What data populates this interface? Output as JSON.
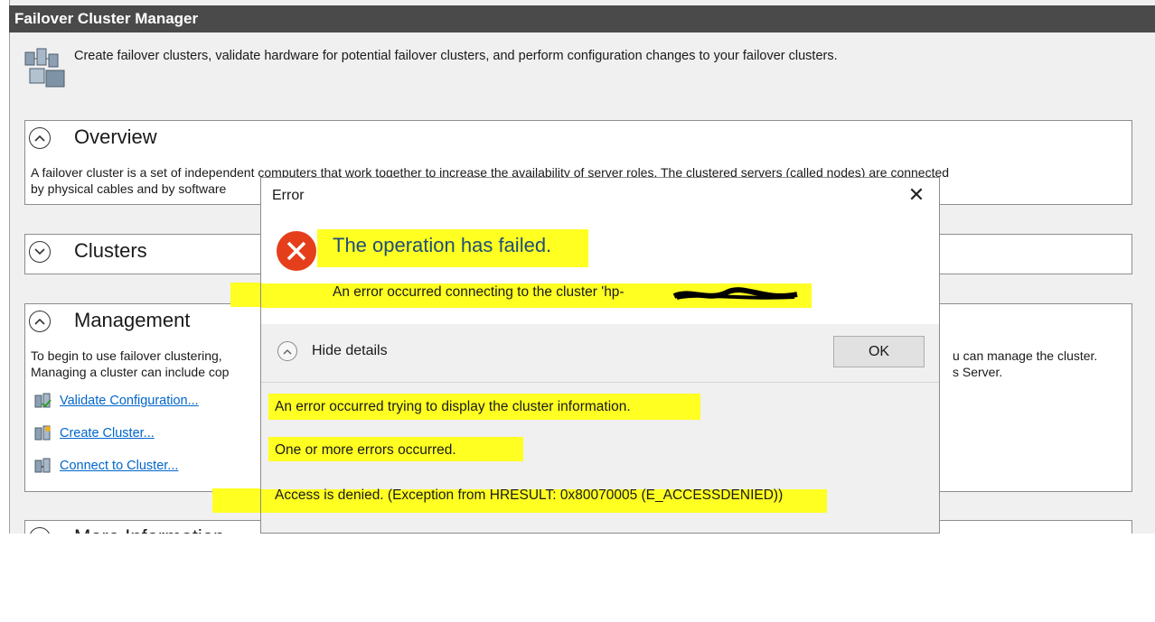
{
  "window": {
    "title": "Failover Cluster Manager"
  },
  "intro": {
    "text": "Create failover clusters, validate hardware for potential failover clusters, and perform configuration changes to your failover clusters."
  },
  "overview": {
    "title": "Overview",
    "line1": "A failover cluster is a set of independent computers that work together to increase the availability of server roles. The clustered servers (called nodes) are connected",
    "line2": "by physical cables and by software"
  },
  "clusters": {
    "title": "Clusters"
  },
  "management": {
    "title": "Management",
    "line1": "To begin to use failover clustering,",
    "line1_right": "u can manage the cluster.",
    "line2": "Managing a cluster can include cop",
    "line2_right": "s Server.",
    "actions": [
      "Validate Configuration...",
      "Create Cluster...",
      "Connect to Cluster..."
    ]
  },
  "more_info": {
    "title": "More Information"
  },
  "dialog": {
    "title": "Error",
    "close_glyph": "✕",
    "main_instruction": "The operation has failed.",
    "content": "An error occurred connecting to the cluster 'hp-",
    "details_label": "Hide details",
    "ok_label": "OK",
    "details": [
      "An error occurred trying to display the cluster information.",
      "One or more errors occurred.",
      "Access is denied. (Exception from HRESULT: 0x80070005 (E_ACCESSDENIED))"
    ]
  },
  "icons": {
    "app": "cluster-manager-icon",
    "error": "error-icon",
    "close": "close-icon",
    "collapse": "chevron-up-icon",
    "expand": "chevron-down-icon"
  },
  "colors": {
    "highlight": "#ffff22",
    "error": "#e53e1b",
    "link": "#0066cc"
  }
}
